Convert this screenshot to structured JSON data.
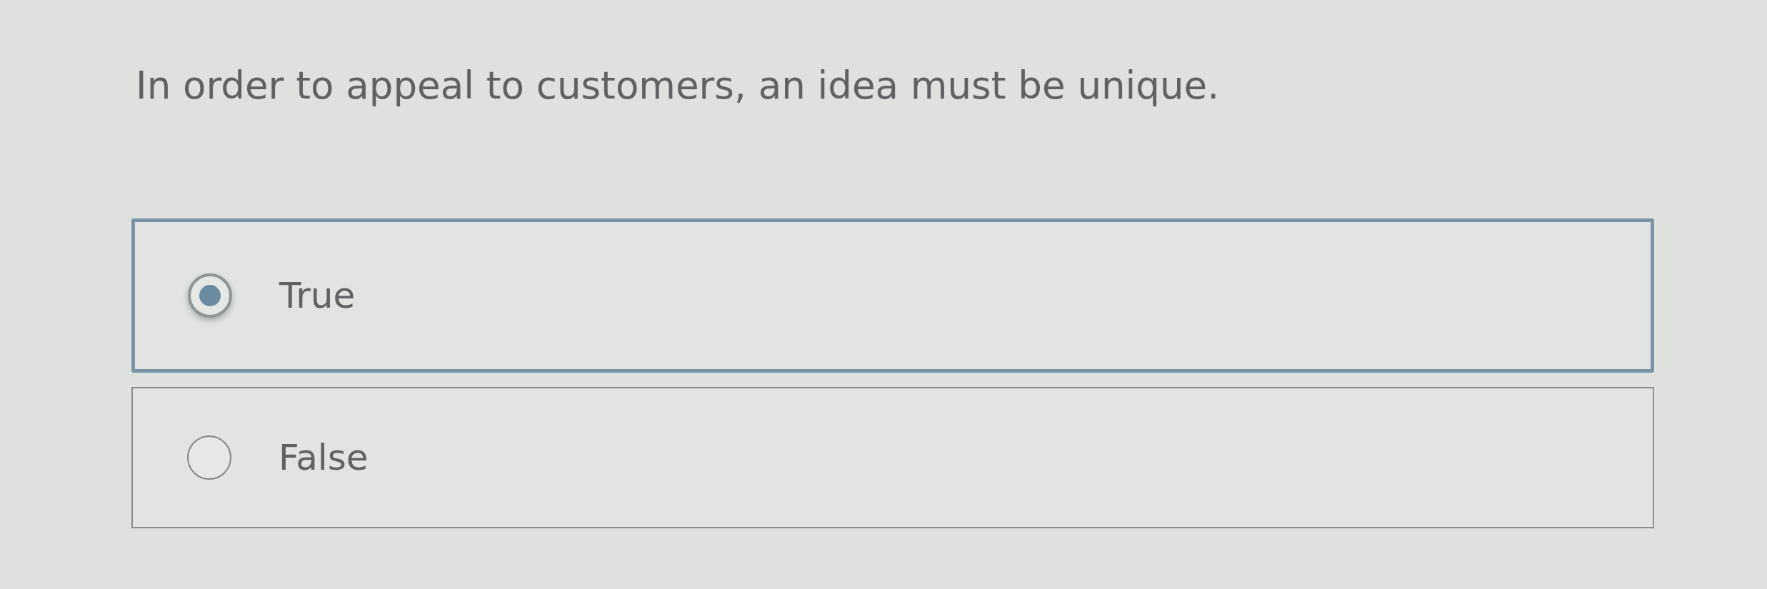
{
  "question": "In order to appeal to customers, an idea must be unique.",
  "options": [
    {
      "label": "True",
      "selected": true
    },
    {
      "label": "False",
      "selected": false
    }
  ]
}
